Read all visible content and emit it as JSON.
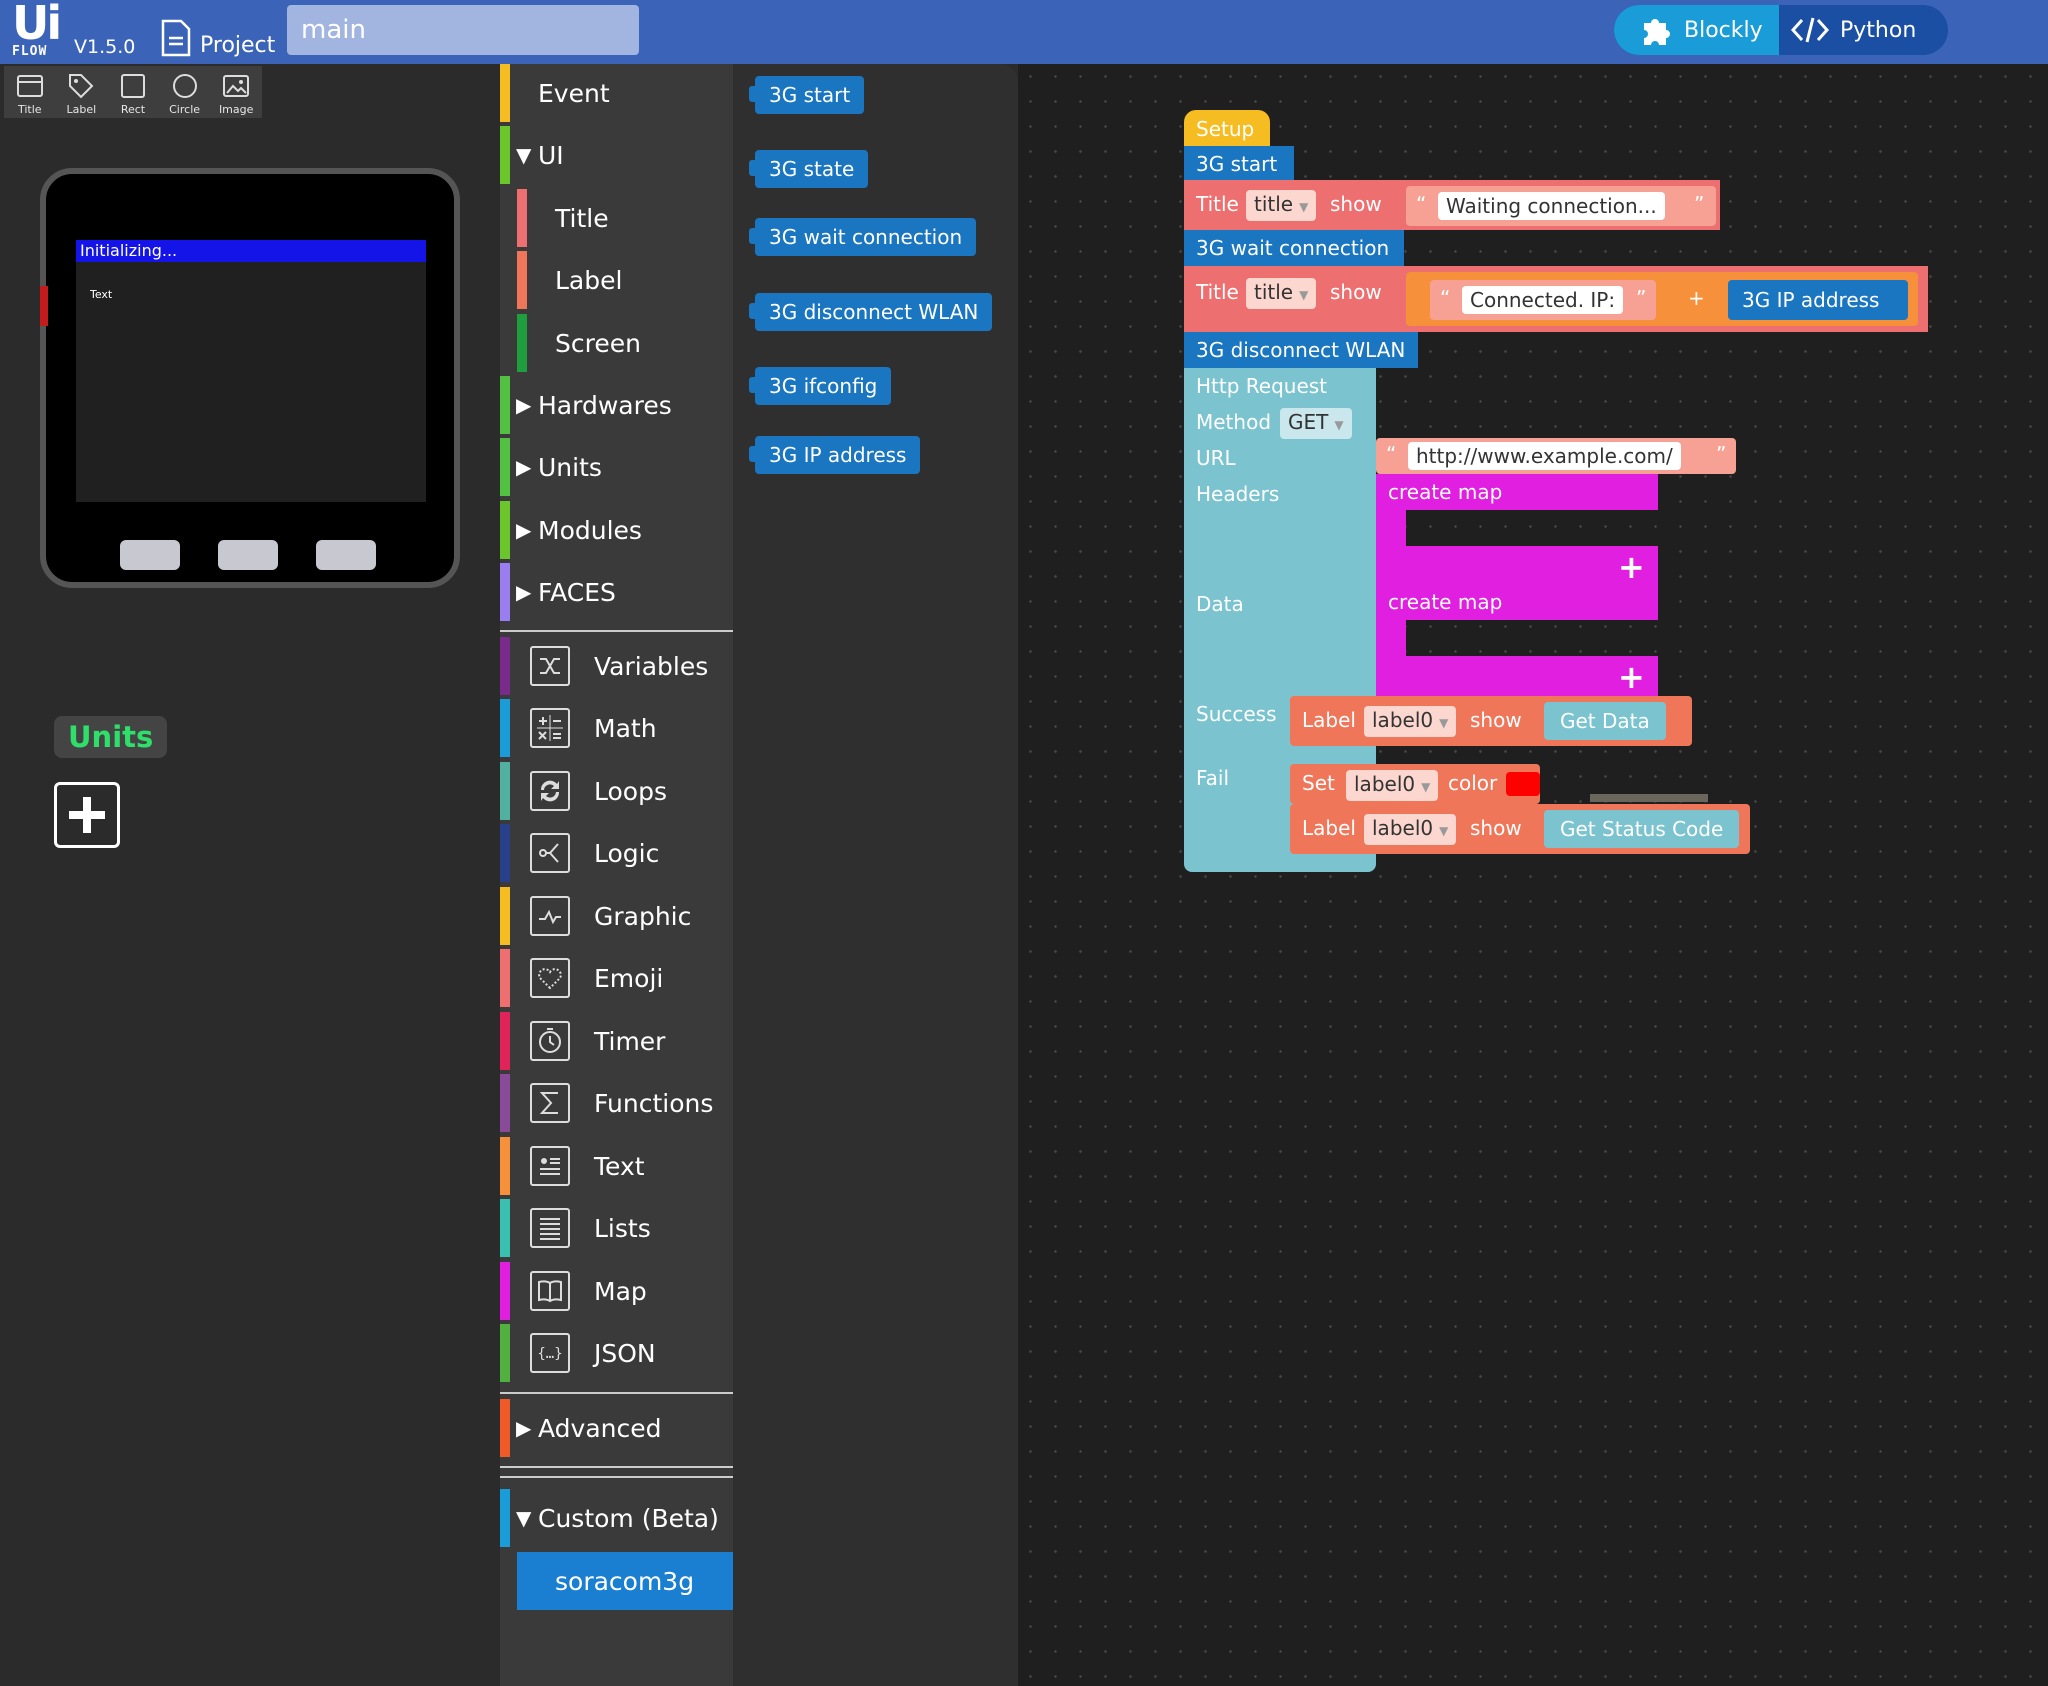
{
  "app": {
    "logo_text": "Ui",
    "logo_sub": "FLOW",
    "version": "V1.5.0",
    "project_label": "Project",
    "file_name": "main",
    "mode_blockly": "Blockly",
    "mode_python": "Python"
  },
  "widgets": [
    "Title",
    "Label",
    "Rect",
    "Circle",
    "Image"
  ],
  "device": {
    "title_text": "Initializing...",
    "label_text": "Text"
  },
  "units": {
    "badge": "Units"
  },
  "categories": {
    "event": "Event",
    "ui": "UI",
    "title": "Title",
    "label": "Label",
    "screen": "Screen",
    "hardwares": "Hardwares",
    "units": "Units",
    "modules": "Modules",
    "faces": "FACES",
    "variables": "Variables",
    "math": "Math",
    "loops": "Loops",
    "logic": "Logic",
    "graphic": "Graphic",
    "emoji": "Emoji",
    "timer": "Timer",
    "functions": "Functions",
    "text": "Text",
    "lists": "Lists",
    "map": "Map",
    "json": "JSON",
    "advanced": "Advanced",
    "custom": "Custom (Beta)",
    "soracom": "soracom3g"
  },
  "category_colors": {
    "event": "#f6bd22",
    "ui": "#6ac62a",
    "title": "#ee6f6f",
    "label": "#f0765a",
    "screen": "#1f9e3e",
    "hardwares": "#52c040",
    "units": "#52c040",
    "modules": "#6ac62a",
    "faces": "#9a7ef0",
    "variables": "#7a2a8a",
    "math": "#1a9cd8",
    "loops": "#52b0a0",
    "logic": "#283f8a",
    "graphic": "#f6bd22",
    "emoji": "#ee6f6f",
    "timer": "#e0245a",
    "functions": "#8a4a9a",
    "text": "#f6903b",
    "lists": "#3ac0b0",
    "map": "#e01fe0",
    "json": "#52b040",
    "advanced": "#f05a28",
    "custom": "#1a9cd8"
  },
  "flyout": [
    "3G start",
    "3G state",
    "3G wait connection",
    "3G disconnect WLAN",
    "3G ifconfig",
    "3G IP address"
  ],
  "program": {
    "setup": "Setup",
    "start": "3G start",
    "title_kw": "Title",
    "title_var": "title",
    "show": "show",
    "waiting_text": "Waiting connection...",
    "wait_conn": "3G wait connection",
    "connected_text": "Connected. IP:",
    "plus": "+",
    "ip_address": "3G IP address",
    "disconnect": "3G disconnect WLAN",
    "http_request": "Http Request",
    "method_label": "Method",
    "method_value": "GET",
    "url_label": "URL",
    "url_value": "http://www.example.com/",
    "headers_label": "Headers",
    "create_map": "create map",
    "data_label": "Data",
    "success_label": "Success",
    "fail_label": "Fail",
    "label_kw": "Label",
    "label_var": "label0",
    "get_data": "Get Data",
    "set_kw": "Set",
    "color_kw": "color",
    "color_value": "#ff0000",
    "get_status": "Get Status Code"
  }
}
